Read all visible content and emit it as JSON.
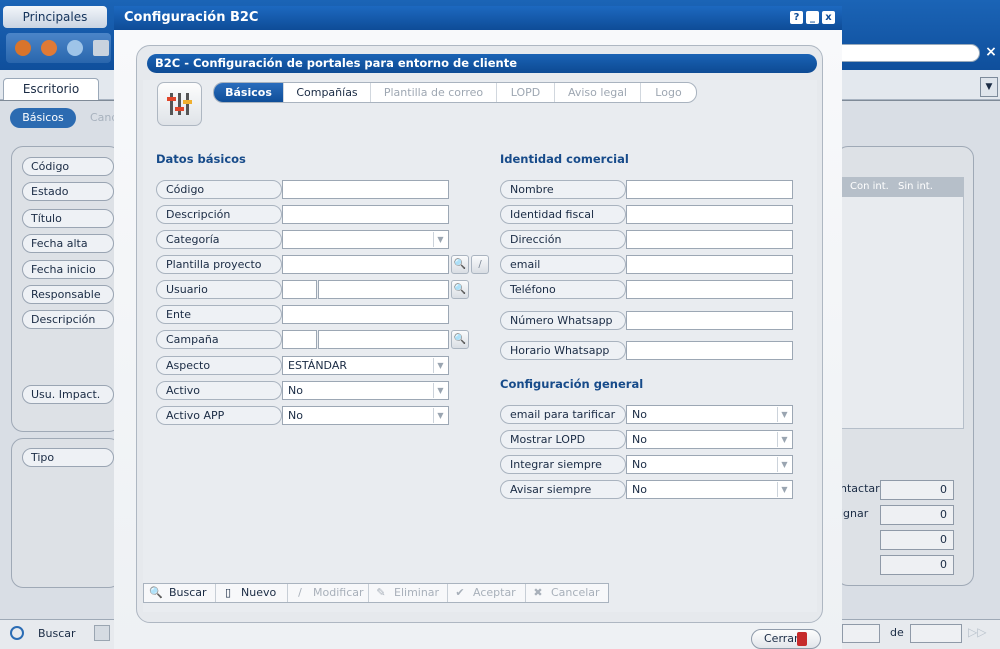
{
  "background": {
    "top_tab": "Principales",
    "desk_tab": "Escritorio",
    "subtabs": [
      "Básicos",
      "Cand"
    ],
    "left_labels_a": [
      "Código",
      "Estado",
      "Título",
      "Fecha alta",
      "Fecha inicio",
      "Responsable",
      "Descripción",
      "Usu. Impact."
    ],
    "left_labels_b": [
      "Tipo"
    ],
    "grid_headers": [
      "Con int.",
      "Sin int."
    ],
    "right_labels": [
      "ntactar",
      "ignar"
    ],
    "right_values": [
      "0",
      "0",
      "0",
      "0"
    ],
    "footer_buscar": "Buscar",
    "footer_de": "de"
  },
  "dialog": {
    "title": "Configuración B2C",
    "window_buttons": [
      "?",
      "_",
      "x"
    ],
    "frame_title": "B2C - Configuración de portales para entorno de cliente",
    "tabs": [
      {
        "label": "Básicos",
        "state": "active"
      },
      {
        "label": "Compañías",
        "state": "enabled"
      },
      {
        "label": "Plantilla de correo",
        "state": "disabled"
      },
      {
        "label": "LOPD",
        "state": "disabled"
      },
      {
        "label": "Aviso legal",
        "state": "disabled"
      },
      {
        "label": "Logo",
        "state": "disabled"
      }
    ],
    "datos_basicos": {
      "title": "Datos básicos",
      "codigo": "Código",
      "descripcion": "Descripción",
      "categoria": "Categoría",
      "plantilla": "Plantilla proyecto",
      "usuario": "Usuario",
      "ente": "Ente",
      "campana": "Campaña",
      "aspecto": "Aspecto",
      "aspecto_value": "ESTÁNDAR",
      "activo": "Activo",
      "activo_value": "No",
      "activo_app": "Activo APP",
      "activo_app_value": "No"
    },
    "identidad": {
      "title": "Identidad comercial",
      "nombre": "Nombre",
      "identidad_fiscal": "Identidad fiscal",
      "direccion": "Dirección",
      "email": "email",
      "telefono": "Teléfono",
      "whatsapp": "Número Whatsapp",
      "horario": "Horario Whatsapp"
    },
    "general": {
      "title": "Configuración general",
      "email_tarificar": "email para tarificar",
      "email_tarificar_value": "No",
      "mostrar_lopd": "Mostrar LOPD",
      "mostrar_lopd_value": "No",
      "integrar": "Integrar siempre",
      "integrar_value": "No",
      "avisar": "Avisar siempre",
      "avisar_value": "No"
    },
    "toolbar": [
      {
        "label": "Buscar",
        "enabled": true,
        "icon": "search-icon"
      },
      {
        "label": "Nuevo",
        "enabled": true,
        "icon": "document-icon"
      },
      {
        "label": "Modificar",
        "enabled": false,
        "icon": "pencil-icon"
      },
      {
        "label": "Eliminar",
        "enabled": false,
        "icon": "eraser-icon"
      },
      {
        "label": "Aceptar",
        "enabled": false,
        "icon": "check-icon"
      },
      {
        "label": "Cancelar",
        "enabled": false,
        "icon": "cross-icon"
      }
    ],
    "close_label": "Cerrar"
  }
}
